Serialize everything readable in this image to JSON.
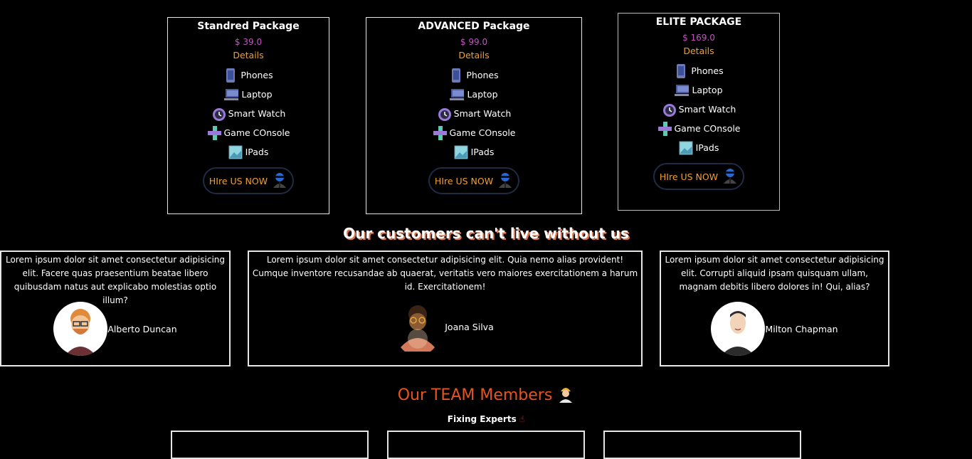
{
  "packages": [
    {
      "title": "Standred Package",
      "price": "$ 39.0",
      "details": "Details",
      "features": [
        "Phones",
        "Laptop",
        "Smart Watch",
        "Game COnsole",
        "IPads"
      ],
      "cta": "HIre US NOW"
    },
    {
      "title": "ADVANCED Package",
      "price": "$ 99.0",
      "details": "Details",
      "features": [
        "Phones",
        "Laptop",
        "Smart Watch",
        "Game COnsole",
        "IPads"
      ],
      "cta": "HIre US NOW"
    },
    {
      "title": "ELITE PACKAGE",
      "price": "$ 169.0",
      "details": "Details",
      "features": [
        "Phones",
        "Laptop",
        "Smart Watch",
        "Game COnsole",
        "IPads"
      ],
      "cta": "HIre US NOW"
    }
  ],
  "feature_icons": [
    "phone-icon",
    "laptop-icon",
    "alarm-clock-icon",
    "game-controller-icon",
    "image-icon"
  ],
  "testimonials_title": "Our customers can't live without us",
  "testimonials": [
    {
      "text": "Lorem ipsum dolor sit amet consectetur adipisicing elit. Facere quas praesentium beatae libero quibusdam natus aut explicabo molestias optio illum?",
      "name": "Alberto Duncan"
    },
    {
      "text": "Lorem ipsum dolor sit amet consectetur adipisicing elit. Quia nemo alias provident! Cumque inventore recusandae ab quaerat, veritatis vero maiores exercitationem a harum id. Exercitationem!",
      "name": "Joana Silva"
    },
    {
      "text": "Lorem ipsum dolor sit amet consectetur adipisicing elit. Corrupti aliquid ipsam quisquam ullam, magnam debitis libero dolores in! Qui, alias?",
      "name": "Milton Chapman"
    }
  ],
  "team": {
    "title": "Our TEAM Members",
    "subtitle": "Fixing Experts"
  },
  "colors": {
    "price": "#c154c1",
    "accent": "#f0a030",
    "team_title": "#e8541f",
    "shadow": "#d8764a"
  }
}
